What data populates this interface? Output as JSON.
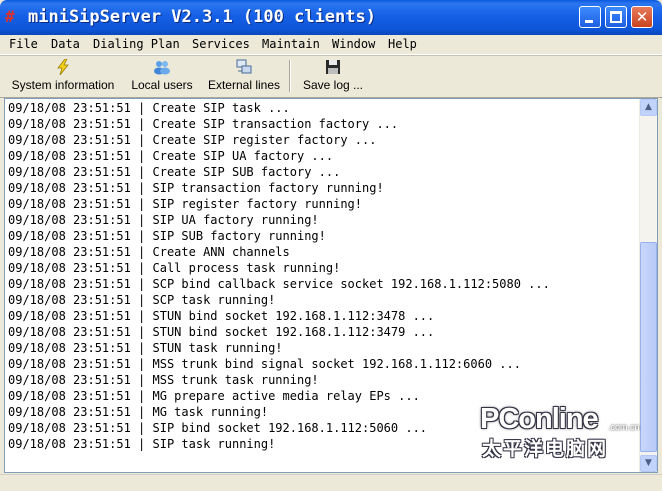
{
  "window": {
    "title": "miniSipServer V2.3.1 (100 clients)",
    "icon_name": "app-logo-icon",
    "controls": [
      "minimize-icon",
      "maximize-icon",
      "close-icon"
    ]
  },
  "menu": {
    "items": [
      "File",
      "Data",
      "Dialing Plan",
      "Services",
      "Maintain",
      "Window",
      "Help"
    ]
  },
  "toolbar": {
    "buttons": [
      {
        "label": "System information",
        "icon": "lightning-icon"
      },
      {
        "label": "Local users",
        "icon": "users-icon"
      },
      {
        "label": "External lines",
        "icon": "network-icon"
      },
      {
        "label": "Save log ...",
        "icon": "floppy-disk-icon"
      }
    ]
  },
  "log": {
    "lines": [
      "09/18/08 23:51:51 | Create SIP task ...",
      "09/18/08 23:51:51 | Create SIP transaction factory ...",
      "09/18/08 23:51:51 | Create SIP register factory ...",
      "09/18/08 23:51:51 | Create SIP UA factory ...",
      "09/18/08 23:51:51 | Create SIP SUB factory ...",
      "09/18/08 23:51:51 | SIP transaction factory running!",
      "09/18/08 23:51:51 | SIP register factory running!",
      "09/18/08 23:51:51 | SIP UA factory running!",
      "09/18/08 23:51:51 | SIP SUB factory running!",
      "09/18/08 23:51:51 | Create ANN channels",
      "09/18/08 23:51:51 | Call process task running!",
      "09/18/08 23:51:51 | SCP bind callback service socket 192.168.1.112:5080 ...",
      "09/18/08 23:51:51 | SCP task running!",
      "09/18/08 23:51:51 | STUN bind socket 192.168.1.112:3478 ...",
      "09/18/08 23:51:51 | STUN bind socket 192.168.1.112:3479 ...",
      "09/18/08 23:51:51 | STUN task running!",
      "09/18/08 23:51:51 | MSS trunk bind signal socket 192.168.1.112:6060 ...",
      "09/18/08 23:51:51 | MSS trunk task running!",
      "09/18/08 23:51:51 | MG prepare active media relay EPs ...",
      "09/18/08 23:51:51 | MG task running!",
      "09/18/08 23:51:51 | SIP bind socket 192.168.1.112:5060 ...",
      "09/18/08 23:51:51 | SIP task running!"
    ]
  },
  "watermark": {
    "logo": "PConline",
    "suffix": ".com.cn",
    "chinese": "太平洋电脑网"
  }
}
